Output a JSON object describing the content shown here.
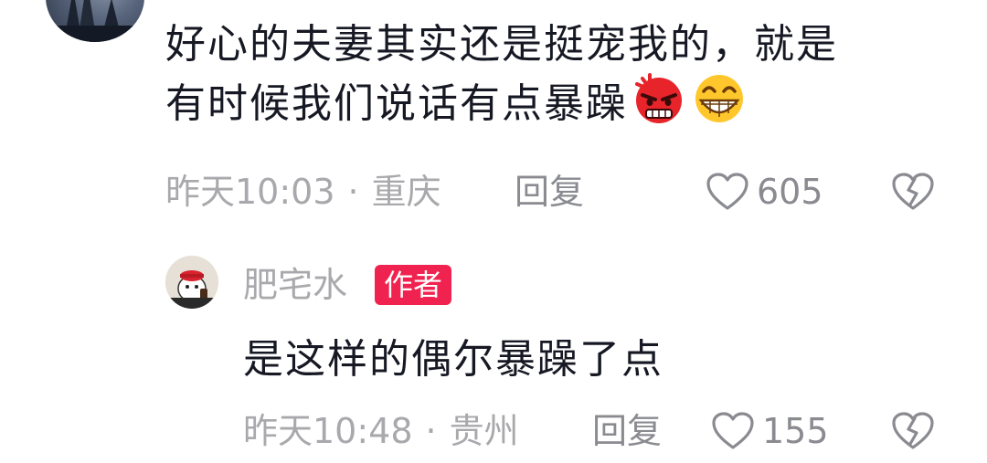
{
  "comment": {
    "text_line1": "好心的夫妻其实还是挺宠我的，就是",
    "text_line2": "有时候我们说话有点暴躁",
    "emojis": [
      "angry-face-icon",
      "grinning-face-icon"
    ],
    "time": "昨天10:03",
    "location": "重庆",
    "separator": "·",
    "reply_label": "回复",
    "likes": "605"
  },
  "reply": {
    "author": "肥宅水",
    "author_badge": "作者",
    "text": "是这样的偶尔暴躁了点",
    "time": "昨天10:48",
    "location": "贵州",
    "separator": "·",
    "reply_label": "回复",
    "likes": "155"
  },
  "colors": {
    "text": "#161823",
    "meta": "#a9a9ad",
    "badge": "#f0224f"
  }
}
